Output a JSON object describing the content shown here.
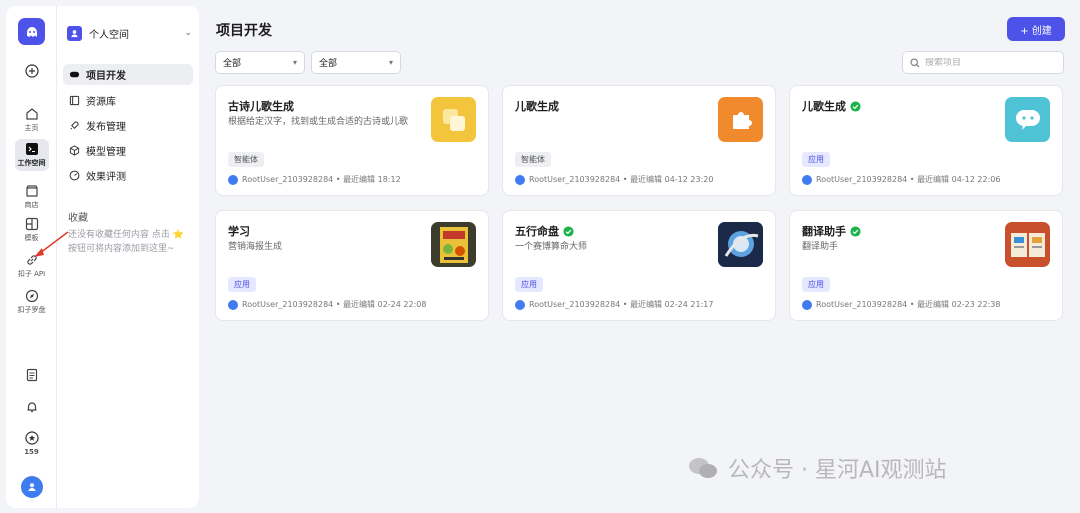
{
  "rail": {
    "items": [
      {
        "label": "主页"
      },
      {
        "label": "工作空间"
      },
      {
        "label": "商店"
      },
      {
        "label": "模板"
      },
      {
        "label": "扣子 API"
      },
      {
        "label": "扣子罗盘"
      }
    ],
    "badge_count": "159"
  },
  "nav": {
    "space_name": "个人空间",
    "items": [
      {
        "label": "项目开发"
      },
      {
        "label": "资源库"
      },
      {
        "label": "发布管理"
      },
      {
        "label": "模型管理"
      },
      {
        "label": "效果评测"
      }
    ],
    "favorites_title": "收藏",
    "favorites_empty": "还没有收藏任何内容 点击 ⭐ 按钮可将内容添加到这里~"
  },
  "main": {
    "title": "项目开发",
    "create_label": "+ 创建",
    "filter1": "全部",
    "filter2": "全部",
    "search_placeholder": "搜索项目"
  },
  "cards": [
    {
      "title": "古诗儿歌生成",
      "verified": false,
      "desc": "根据给定汉字，找到或生成合适的古诗或儿歌",
      "tag": "智能体",
      "owner": "RootUser_2103928284",
      "meta": "RootUser_2103928284 • 最近编辑 18:12",
      "thumb": "yellow-squares-icon",
      "thumb_color": "#f2c53d"
    },
    {
      "title": "儿歌生成",
      "verified": false,
      "desc": "",
      "tag": "智能体",
      "owner": "RootUser_2103928284",
      "meta": "RootUser_2103928284 • 最近编辑 04-12 23:20",
      "thumb": "puzzle-icon",
      "thumb_color": "#f08a2c"
    },
    {
      "title": "儿歌生成",
      "verified": true,
      "desc": "",
      "tag": "应用",
      "owner": "RootUser_2103928284",
      "meta": "RootUser_2103928284 • 最近编辑 04-12 22:06",
      "thumb": "chat-bubble-icon",
      "thumb_color": "#4fc3d6"
    },
    {
      "title": "学习",
      "verified": false,
      "desc": "营销海报生成",
      "tag": "应用",
      "owner": "RootUser_2103928284",
      "meta": "RootUser_2103928284 • 最近编辑 02-24 22:08",
      "thumb": "poster-thumbnail",
      "thumb_color": "#3d3d2e"
    },
    {
      "title": "五行命盘",
      "verified": true,
      "desc": "一个赛博算命大师",
      "tag": "应用",
      "owner": "RootUser_2103928284",
      "meta": "RootUser_2103928284 • 最近编辑 02-24 21:17",
      "thumb": "orb-thumbnail",
      "thumb_color": "#1e3c6e"
    },
    {
      "title": "翻译助手",
      "verified": true,
      "desc": "翻译助手",
      "tag": "应用",
      "owner": "RootUser_2103928284",
      "meta": "RootUser_2103928284 • 最近编辑 02-23 22:38",
      "thumb": "book-thumbnail",
      "thumb_color": "#c8502c"
    }
  ],
  "watermark": "公众号 · 星河AI观测站",
  "colors": {
    "accent": "#4d53e8",
    "verified": "#19b34a",
    "page_bg": "#f3f4f7"
  }
}
